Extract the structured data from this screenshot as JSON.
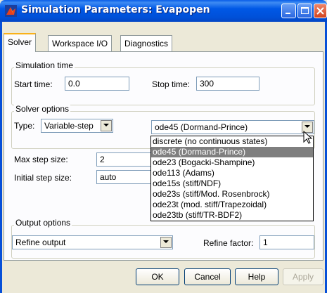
{
  "window": {
    "title": "Simulation Parameters: Evapopen",
    "colors": {
      "titlebar": "#0058e6",
      "face": "#ece9d8",
      "selection": "#7f7f7f"
    }
  },
  "tabs": [
    {
      "label": "Solver",
      "active": true
    },
    {
      "label": "Workspace I/O",
      "active": false
    },
    {
      "label": "Diagnostics",
      "active": false
    }
  ],
  "simulation_time": {
    "group_label": "Simulation time",
    "start_label": "Start time:",
    "start_value": "0.0",
    "stop_label": "Stop time:",
    "stop_value": "300"
  },
  "solver_options": {
    "group_label": "Solver options",
    "type_label": "Type:",
    "type_value": "Variable-step",
    "solver_value": "ode45 (Dormand-Prince)",
    "max_step_label": "Max step size:",
    "max_step_value": "2",
    "initial_step_label": "Initial step size:",
    "initial_step_value": "auto",
    "solver_list": [
      "discrete (no continuous states)",
      "ode45 (Dormand-Prince)",
      "ode23 (Bogacki-Shampine)",
      "ode113 (Adams)",
      "ode15s (stiff/NDF)",
      "ode23s (stiff/Mod. Rosenbrock)",
      "ode23t (mod. stiff/Trapezoidal)",
      "ode23tb (stiff/TR-BDF2)"
    ],
    "selected_index": 1
  },
  "output_options": {
    "group_label": "Output options",
    "output_value": "Refine output",
    "refine_label": "Refine factor:",
    "refine_value": "1"
  },
  "buttons": {
    "ok": "OK",
    "cancel": "Cancel",
    "help": "Help",
    "apply": "Apply"
  }
}
